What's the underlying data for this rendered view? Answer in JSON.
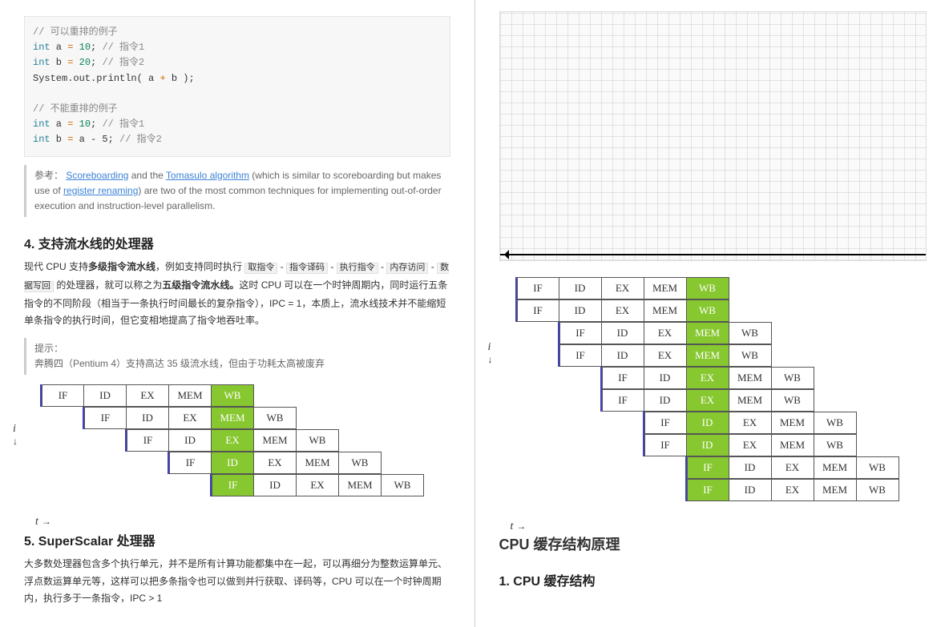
{
  "left": {
    "code": {
      "c1": "// 可以重排的例子",
      "l1a": "int",
      "l1b": " a ",
      "l1c": "=",
      "l1d": " 10",
      "l1e": "; ",
      "l1f": "// 指令1",
      "l2a": "int",
      "l2b": " b ",
      "l2c": "=",
      "l2d": " 20",
      "l2e": "; ",
      "l2f": "// 指令2",
      "l3a": "System.out.println( a ",
      "l3b": "+",
      "l3c": " b );",
      "c2": "// 不能重排的例子",
      "l4a": "int",
      "l4b": " a ",
      "l4c": "=",
      "l4d": " 10",
      "l4e": "; ",
      "l4f": "// 指令1",
      "l5a": "int",
      "l5b": " b ",
      "l5c": "=",
      "l5d": " a - 5",
      "l5e": "; ",
      "l5f": "// 指令2"
    },
    "ref": {
      "prefix": "参考：",
      "link1": "Scoreboarding",
      "mid1": " and the ",
      "link2": "Tomasulo algorithm",
      "mid2": " (which is similar to scoreboarding but makes use of ",
      "link3": "register renaming",
      "tail": ") are two of the most common techniques for implementing out-of-order execution and instruction-level parallelism."
    },
    "sec4": {
      "title": "4. 支持流水线的处理器",
      "p_a": "现代 CPU 支持",
      "p_bold1": "多级指令流水线",
      "p_b": "，例如支持同时执行 ",
      "stages": [
        "取指令",
        "指令译码",
        "执行指令",
        "内存访问",
        "数据写回"
      ],
      "p_c": " 的处理器，就可以称之为",
      "p_bold2": "五级指令流水线。",
      "p_d": "这时 CPU 可以在一个时钟周期内，同时运行五条指令的不同阶段（相当于一条执行时间最长的复杂指令），IPC = 1，本质上，流水线技术并不能缩短单条指令的执行时间，但它变相地提高了指令地吞吐率。",
      "tip_label": "提示：",
      "tip_body": "奔腾四（Pentium 4）支持高达 35 级流水线，但由于功耗太高被废弃"
    },
    "sec5": {
      "title": "5. SuperScalar 处理器",
      "p": "大多数处理器包含多个执行单元，并不是所有计算功能都集中在一起，可以再细分为整数运算单元、浮点数运算单元等，这样可以把多条指令也可以做到并行获取、译码等，CPU 可以在一个时钟周期内，执行多于一条指令，IPC > 1"
    },
    "axis_i": "i",
    "axis_t": "t",
    "pipe_labels": [
      "IF",
      "ID",
      "EX",
      "MEM",
      "WB"
    ]
  },
  "right": {
    "h_cache": "CPU 缓存结构原理",
    "h_cache_sub": "1. CPU 缓存结构",
    "axis_i": "i",
    "axis_t": "t",
    "pipe_labels": [
      "IF",
      "ID",
      "EX",
      "MEM",
      "WB"
    ]
  },
  "chart_data": [
    {
      "type": "table",
      "name": "left-5-stage-pipeline",
      "rows": [
        [
          "IF",
          "ID",
          "EX",
          "MEM",
          "WB*",
          "",
          "",
          "",
          ""
        ],
        [
          "",
          "IF",
          "ID",
          "EX",
          "MEM*",
          "WB",
          "",
          "",
          ""
        ],
        [
          "",
          "",
          "IF",
          "ID",
          "EX*",
          "MEM",
          "WB",
          "",
          ""
        ],
        [
          "",
          "",
          "",
          "IF",
          "ID*",
          "EX",
          "MEM",
          "WB",
          ""
        ],
        [
          "",
          "",
          "",
          "",
          "IF*",
          "ID",
          "EX",
          "MEM",
          "WB"
        ]
      ],
      "note": "* indicates highlighted diagonal cell (green)"
    },
    {
      "type": "table",
      "name": "right-superscalar-pipeline",
      "rows": [
        [
          "IF",
          "ID",
          "EX",
          "MEM",
          "WB*",
          "",
          "",
          "",
          "",
          ""
        ],
        [
          "IF",
          "ID",
          "EX",
          "MEM",
          "WB*",
          "",
          "",
          "",
          "",
          ""
        ],
        [
          "",
          "IF",
          "ID",
          "EX",
          "MEM*",
          "WB",
          "",
          "",
          "",
          ""
        ],
        [
          "",
          "IF",
          "ID",
          "EX",
          "MEM*",
          "WB",
          "",
          "",
          "",
          ""
        ],
        [
          "",
          "",
          "IF",
          "ID",
          "EX*",
          "MEM",
          "WB",
          "",
          "",
          ""
        ],
        [
          "",
          "",
          "IF",
          "ID",
          "EX*",
          "MEM",
          "WB",
          "",
          "",
          ""
        ],
        [
          "",
          "",
          "",
          "IF",
          "ID*",
          "EX",
          "MEM",
          "WB",
          "",
          ""
        ],
        [
          "",
          "",
          "",
          "IF",
          "ID*",
          "EX",
          "MEM",
          "WB",
          "",
          ""
        ],
        [
          "",
          "",
          "",
          "",
          "IF*",
          "ID",
          "EX",
          "MEM",
          "WB",
          ""
        ],
        [
          "",
          "",
          "",
          "",
          "IF*",
          "ID",
          "EX",
          "MEM",
          "WB",
          ""
        ]
      ]
    }
  ]
}
